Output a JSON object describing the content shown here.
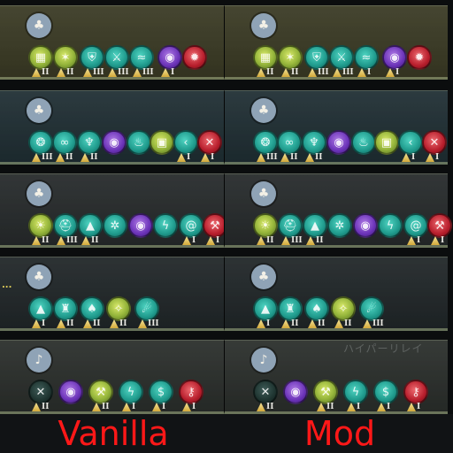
{
  "labels": {
    "left": "Vanilla",
    "right": "Mod"
  },
  "watermark_text": "ハイパーリレイ",
  "ellipsis": "...",
  "panels": [
    {
      "theme": "gold",
      "class_icon": "warrior-class-icon",
      "left": [
        {
          "icon": "fortress-icon",
          "color": "green",
          "tier": "II"
        },
        {
          "icon": "star-emblem-icon",
          "color": "green",
          "tier": "II"
        },
        {
          "icon": "shield-icon",
          "color": "teal",
          "tier": "III"
        },
        {
          "icon": "sword-ring-icon",
          "color": "teal",
          "tier": "III"
        },
        {
          "icon": "wave-icon",
          "color": "teal",
          "tier": "III"
        },
        {
          "icon": "signal-icon",
          "color": "purple",
          "tier": "I"
        },
        {
          "icon": "strike-icon",
          "color": "red",
          "tier": ""
        }
      ],
      "right": [
        {
          "icon": "fortress-icon",
          "color": "green",
          "tier": "II"
        },
        {
          "icon": "star-emblem-icon",
          "color": "green",
          "tier": "II"
        },
        {
          "icon": "shield-icon",
          "color": "teal",
          "tier": "III"
        },
        {
          "icon": "sword-ring-icon",
          "color": "teal",
          "tier": "III"
        },
        {
          "icon": "wave-icon",
          "color": "teal",
          "tier": "I"
        },
        {
          "icon": "signal-icon",
          "color": "purple",
          "tier": "I"
        },
        {
          "icon": "strike-icon",
          "color": "red",
          "tier": ""
        }
      ]
    },
    {
      "theme": "teal",
      "class_icon": "warrior-class-icon",
      "left": [
        {
          "icon": "brain-icon",
          "color": "teal",
          "tier": "III"
        },
        {
          "icon": "goggles-icon",
          "color": "teal",
          "tier": "II"
        },
        {
          "icon": "figure-icon",
          "color": "teal",
          "tier": "II"
        },
        {
          "icon": "signal-icon",
          "color": "purple",
          "tier": ""
        },
        {
          "icon": "flame-icon",
          "color": "teal",
          "tier": ""
        },
        {
          "icon": "display-icon",
          "color": "green",
          "tier": ""
        },
        {
          "icon": "chevron-icon",
          "color": "teal",
          "tier": "I"
        },
        {
          "icon": "slash-icon",
          "color": "red",
          "tier": "I"
        }
      ],
      "right": [
        {
          "icon": "brain-icon",
          "color": "teal",
          "tier": "III"
        },
        {
          "icon": "goggles-icon",
          "color": "teal",
          "tier": "II"
        },
        {
          "icon": "figure-icon",
          "color": "teal",
          "tier": "II"
        },
        {
          "icon": "signal-icon",
          "color": "purple",
          "tier": ""
        },
        {
          "icon": "flame-icon",
          "color": "teal",
          "tier": ""
        },
        {
          "icon": "display-icon",
          "color": "green",
          "tier": ""
        },
        {
          "icon": "chevron-icon",
          "color": "teal",
          "tier": "I"
        },
        {
          "icon": "slash-icon",
          "color": "red",
          "tier": "I"
        }
      ]
    },
    {
      "theme": "slate",
      "class_icon": "warrior-class-icon",
      "left": [
        {
          "icon": "sun-burst-icon",
          "color": "green",
          "tier": "II"
        },
        {
          "icon": "helmet-icon",
          "color": "teal",
          "tier": "III"
        },
        {
          "icon": "rocket-icon",
          "color": "teal",
          "tier": "II"
        },
        {
          "icon": "gear-icon",
          "color": "teal",
          "tier": ""
        },
        {
          "icon": "signal-icon",
          "color": "purple",
          "tier": ""
        },
        {
          "icon": "bolt-icon",
          "color": "teal",
          "tier": ""
        },
        {
          "icon": "spiral-icon",
          "color": "teal",
          "tier": "I"
        },
        {
          "icon": "hammer-icon",
          "color": "red",
          "tier": "I"
        }
      ],
      "right": [
        {
          "icon": "sun-burst-icon",
          "color": "green",
          "tier": "II"
        },
        {
          "icon": "helmet-icon",
          "color": "teal",
          "tier": "III"
        },
        {
          "icon": "rocket-icon",
          "color": "teal",
          "tier": "II"
        },
        {
          "icon": "gear-icon",
          "color": "teal",
          "tier": ""
        },
        {
          "icon": "signal-icon",
          "color": "purple",
          "tier": ""
        },
        {
          "icon": "bolt-icon",
          "color": "teal",
          "tier": ""
        },
        {
          "icon": "spiral-icon",
          "color": "teal",
          "tier": "I"
        },
        {
          "icon": "hammer-icon",
          "color": "red",
          "tier": "I"
        }
      ]
    },
    {
      "theme": "dark",
      "class_icon": "warrior-class-icon",
      "left": [
        {
          "icon": "rocket-icon",
          "color": "teal",
          "tier": "I"
        },
        {
          "icon": "cart-icon",
          "color": "teal",
          "tier": "II"
        },
        {
          "icon": "tree-icon",
          "color": "teal",
          "tier": "II"
        },
        {
          "icon": "crest-icon",
          "color": "green",
          "tier": "II"
        },
        {
          "icon": "comet-icon",
          "color": "teal",
          "tier": "III"
        }
      ],
      "right": [
        {
          "icon": "rocket-icon",
          "color": "teal",
          "tier": "I"
        },
        {
          "icon": "cart-icon",
          "color": "teal",
          "tier": "II"
        },
        {
          "icon": "tree-icon",
          "color": "teal",
          "tier": "II"
        },
        {
          "icon": "crest-icon",
          "color": "green",
          "tier": "II"
        },
        {
          "icon": "comet-icon",
          "color": "teal",
          "tier": "III"
        }
      ]
    },
    {
      "theme": "gray",
      "class_icon": "support-class-icon",
      "left": [
        {
          "icon": "cross-icon",
          "color": "dark",
          "tier": "II"
        },
        {
          "icon": "signal-icon",
          "color": "purple",
          "tier": ""
        },
        {
          "icon": "tools-icon",
          "color": "green",
          "tier": "II"
        },
        {
          "icon": "bolt-icon",
          "color": "teal",
          "tier": "I"
        },
        {
          "icon": "money-bag-icon",
          "color": "teal",
          "tier": "I"
        },
        {
          "icon": "key-icon",
          "color": "red",
          "tier": "I"
        }
      ],
      "right": [
        {
          "icon": "cross-icon",
          "color": "dark",
          "tier": "II"
        },
        {
          "icon": "signal-icon",
          "color": "purple",
          "tier": ""
        },
        {
          "icon": "tools-icon",
          "color": "green",
          "tier": "II"
        },
        {
          "icon": "bolt-icon",
          "color": "teal",
          "tier": "I"
        },
        {
          "icon": "money-bag-icon",
          "color": "teal",
          "tier": "I"
        },
        {
          "icon": "key-icon",
          "color": "red",
          "tier": "I"
        }
      ]
    }
  ]
}
